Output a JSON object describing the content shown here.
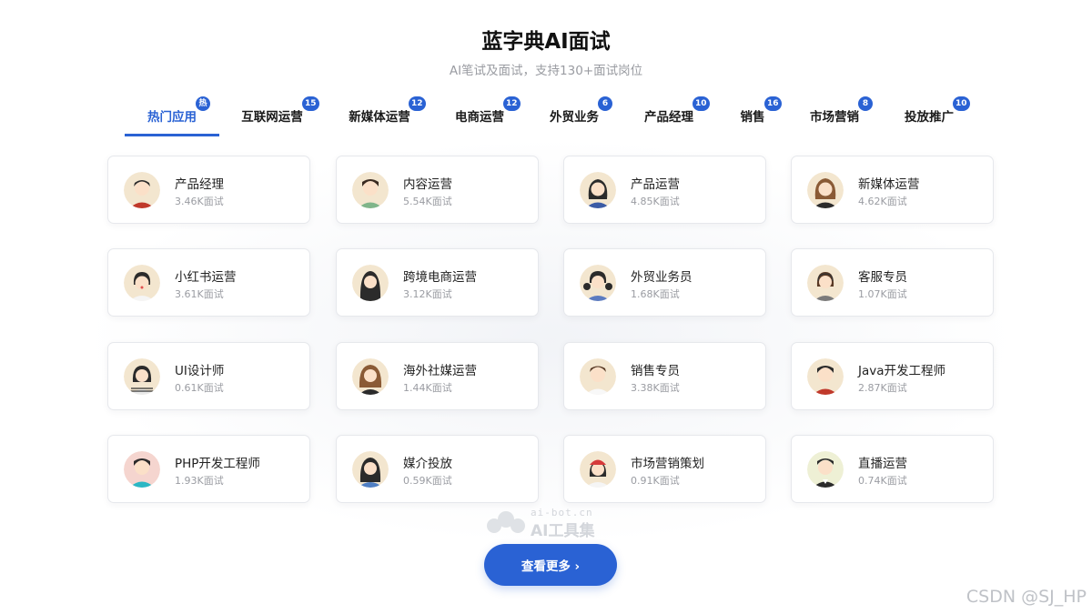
{
  "header": {
    "title": "蓝字典AI面试",
    "subtitle": "AI笔试及面试，支持130+面试岗位"
  },
  "tabs": [
    {
      "label": "热门应用",
      "badge": "热",
      "active": true
    },
    {
      "label": "互联网运营",
      "badge": "15"
    },
    {
      "label": "新媒体运营",
      "badge": "12"
    },
    {
      "label": "电商运营",
      "badge": "12"
    },
    {
      "label": "外贸业务",
      "badge": "6"
    },
    {
      "label": "产品经理",
      "badge": "10"
    },
    {
      "label": "销售",
      "badge": "16"
    },
    {
      "label": "市场营销",
      "badge": "8"
    },
    {
      "label": "投放推广",
      "badge": "10"
    }
  ],
  "cards": [
    {
      "name": "产品经理",
      "count": "3.46K面试",
      "avatar": "male-avatar-red-shirt"
    },
    {
      "name": "内容运营",
      "count": "5.54K面试",
      "avatar": "male-avatar-green-shirt"
    },
    {
      "name": "产品运营",
      "count": "4.85K面试",
      "avatar": "female-avatar-long-hair"
    },
    {
      "name": "新媒体运营",
      "count": "4.62K面试",
      "avatar": "female-avatar-brown-hair"
    },
    {
      "name": "小红书运营",
      "count": "3.61K面试",
      "avatar": "female-avatar-short-hair"
    },
    {
      "name": "跨境电商运营",
      "count": "3.12K面试",
      "avatar": "female-avatar-long-dark-hair"
    },
    {
      "name": "外贸业务员",
      "count": "1.68K面试",
      "avatar": "female-avatar-pigtails"
    },
    {
      "name": "客服专员",
      "count": "1.07K面试",
      "avatar": "female-avatar-headset"
    },
    {
      "name": "UI设计师",
      "count": "0.61K面试",
      "avatar": "female-avatar-striped-shirt"
    },
    {
      "name": "海外社媒运营",
      "count": "1.44K面试",
      "avatar": "female-avatar-wavy-hair"
    },
    {
      "name": "销售专员",
      "count": "3.38K面试",
      "avatar": "male-avatar-white-shirt"
    },
    {
      "name": "Java开发工程师",
      "count": "2.87K面试",
      "avatar": "male-avatar-red-sweater"
    },
    {
      "name": "PHP开发工程师",
      "count": "1.93K面试",
      "avatar": "male-avatar-teal-shirt"
    },
    {
      "name": "媒介投放",
      "count": "0.59K面试",
      "avatar": "female-avatar-braids"
    },
    {
      "name": "市场营销策划",
      "count": "0.91K面试",
      "avatar": "female-avatar-red-cap"
    },
    {
      "name": "直播运营",
      "count": "0.74K面试",
      "avatar": "male-avatar-suit"
    }
  ],
  "more_button": {
    "label": "查看更多 ›"
  },
  "watermarks": {
    "site_url": "ai-bot.cn",
    "site_name": "AI工具集",
    "credit": "CSDN @SJ_HP"
  },
  "colors": {
    "accent": "#2a62d4",
    "muted_text": "#9a9ca2",
    "card_border": "#e6e8ec"
  }
}
